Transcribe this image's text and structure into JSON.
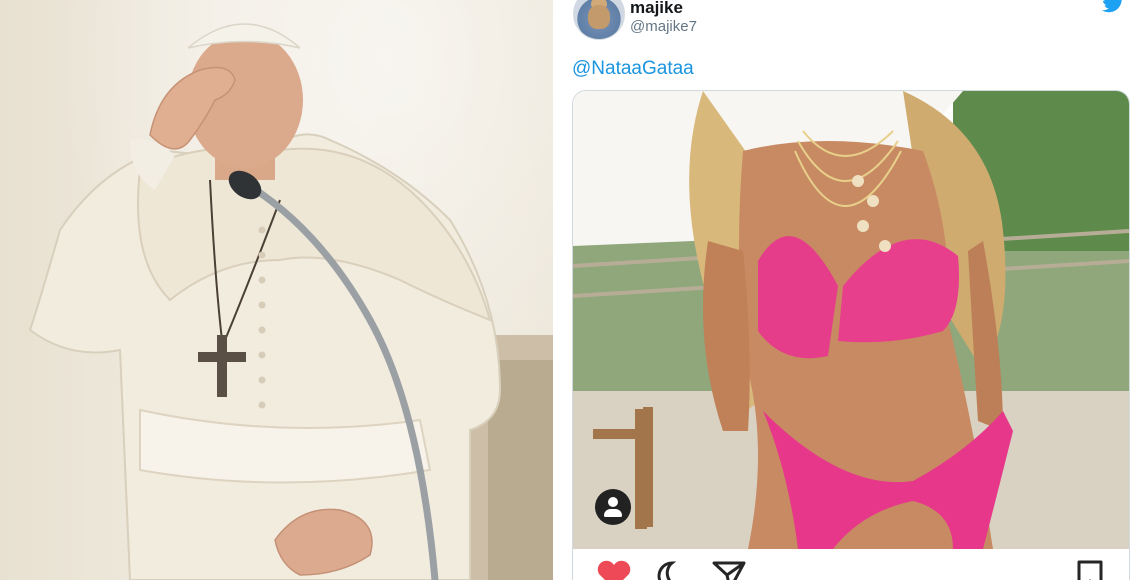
{
  "tweet": {
    "display_name": "majike",
    "handle": "@majike7",
    "mention": "@NataaGataa"
  },
  "icons": {
    "brand": "twitter-bird-icon",
    "media_overlay": "person-icon",
    "actions": [
      "heart-icon",
      "comment-icon",
      "share-icon",
      "bookmark-icon"
    ]
  },
  "colors": {
    "link": "#1b95e0",
    "heart": "#ed4956",
    "brand": "#1da1f2"
  }
}
